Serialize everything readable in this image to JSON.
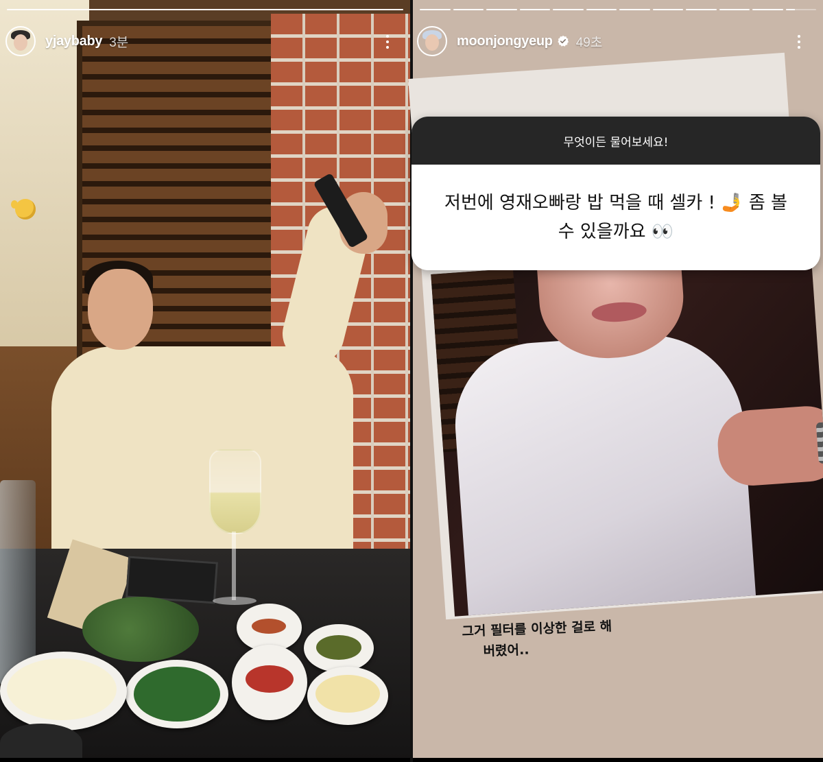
{
  "stories": [
    {
      "username": "yjaybaby",
      "time": "3분",
      "avatar_icon": "avatar-icon",
      "progress": {
        "segments": 1,
        "filled_fraction": 1.0
      },
      "colors": {
        "hair": "#2d2a28"
      }
    },
    {
      "username": "moonjongyeup",
      "time": "49초",
      "verified": true,
      "avatar_icon": "avatar-icon",
      "progress": {
        "segments": 12,
        "completed_segments": 11,
        "current_fraction": 0.3
      },
      "question_sticker": {
        "header": "무엇이든 물어보세요!",
        "question_line1": "저번에 영재오빠랑 밥 먹을 때 셀카 ! 🤳 좀 볼",
        "question_line2": "수 있을까요 👀"
      },
      "reply_line1": "그거 필터를 이상한 걸로 해",
      "reply_line2": "버렸어..",
      "colors": {
        "hair": "#c9d5e6",
        "verified": "#ffffff",
        "sticker_header_bg": "#262626"
      }
    }
  ]
}
